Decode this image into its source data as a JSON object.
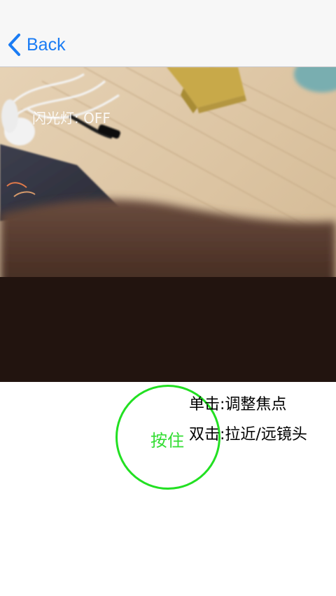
{
  "nav": {
    "back_label": "Back",
    "accent_color": "#1a7cf4"
  },
  "camera": {
    "flash_status": "闪光灯: OFF"
  },
  "capture": {
    "button_label": "按住",
    "ring_color": "#22e022"
  },
  "hints": {
    "single_tap": "单击:调整焦点",
    "double_tap": "双击:拉近/远镜头"
  }
}
